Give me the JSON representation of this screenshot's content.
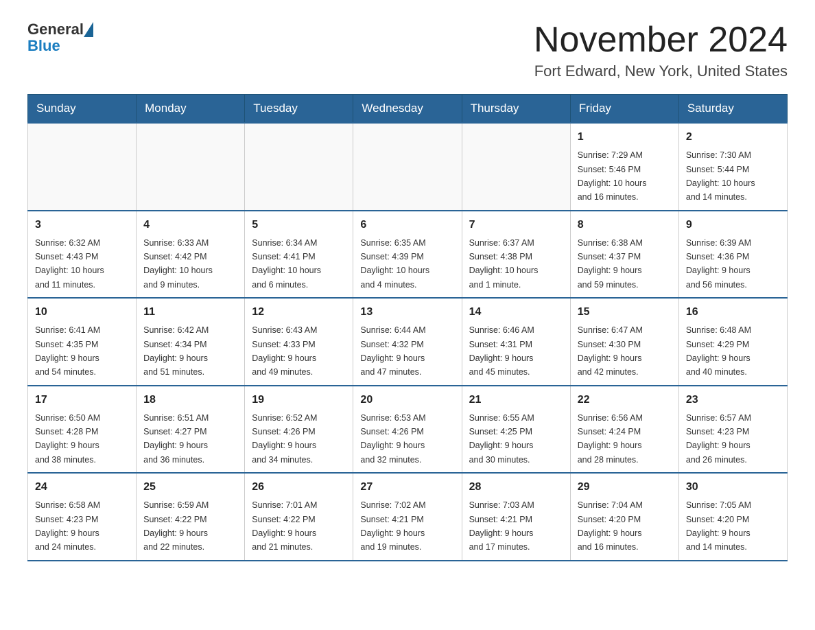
{
  "header": {
    "logo_general": "General",
    "logo_blue": "Blue",
    "month_title": "November 2024",
    "location": "Fort Edward, New York, United States"
  },
  "days_of_week": [
    "Sunday",
    "Monday",
    "Tuesday",
    "Wednesday",
    "Thursday",
    "Friday",
    "Saturday"
  ],
  "weeks": [
    [
      {
        "day": "",
        "info": ""
      },
      {
        "day": "",
        "info": ""
      },
      {
        "day": "",
        "info": ""
      },
      {
        "day": "",
        "info": ""
      },
      {
        "day": "",
        "info": ""
      },
      {
        "day": "1",
        "info": "Sunrise: 7:29 AM\nSunset: 5:46 PM\nDaylight: 10 hours\nand 16 minutes."
      },
      {
        "day": "2",
        "info": "Sunrise: 7:30 AM\nSunset: 5:44 PM\nDaylight: 10 hours\nand 14 minutes."
      }
    ],
    [
      {
        "day": "3",
        "info": "Sunrise: 6:32 AM\nSunset: 4:43 PM\nDaylight: 10 hours\nand 11 minutes."
      },
      {
        "day": "4",
        "info": "Sunrise: 6:33 AM\nSunset: 4:42 PM\nDaylight: 10 hours\nand 9 minutes."
      },
      {
        "day": "5",
        "info": "Sunrise: 6:34 AM\nSunset: 4:41 PM\nDaylight: 10 hours\nand 6 minutes."
      },
      {
        "day": "6",
        "info": "Sunrise: 6:35 AM\nSunset: 4:39 PM\nDaylight: 10 hours\nand 4 minutes."
      },
      {
        "day": "7",
        "info": "Sunrise: 6:37 AM\nSunset: 4:38 PM\nDaylight: 10 hours\nand 1 minute."
      },
      {
        "day": "8",
        "info": "Sunrise: 6:38 AM\nSunset: 4:37 PM\nDaylight: 9 hours\nand 59 minutes."
      },
      {
        "day": "9",
        "info": "Sunrise: 6:39 AM\nSunset: 4:36 PM\nDaylight: 9 hours\nand 56 minutes."
      }
    ],
    [
      {
        "day": "10",
        "info": "Sunrise: 6:41 AM\nSunset: 4:35 PM\nDaylight: 9 hours\nand 54 minutes."
      },
      {
        "day": "11",
        "info": "Sunrise: 6:42 AM\nSunset: 4:34 PM\nDaylight: 9 hours\nand 51 minutes."
      },
      {
        "day": "12",
        "info": "Sunrise: 6:43 AM\nSunset: 4:33 PM\nDaylight: 9 hours\nand 49 minutes."
      },
      {
        "day": "13",
        "info": "Sunrise: 6:44 AM\nSunset: 4:32 PM\nDaylight: 9 hours\nand 47 minutes."
      },
      {
        "day": "14",
        "info": "Sunrise: 6:46 AM\nSunset: 4:31 PM\nDaylight: 9 hours\nand 45 minutes."
      },
      {
        "day": "15",
        "info": "Sunrise: 6:47 AM\nSunset: 4:30 PM\nDaylight: 9 hours\nand 42 minutes."
      },
      {
        "day": "16",
        "info": "Sunrise: 6:48 AM\nSunset: 4:29 PM\nDaylight: 9 hours\nand 40 minutes."
      }
    ],
    [
      {
        "day": "17",
        "info": "Sunrise: 6:50 AM\nSunset: 4:28 PM\nDaylight: 9 hours\nand 38 minutes."
      },
      {
        "day": "18",
        "info": "Sunrise: 6:51 AM\nSunset: 4:27 PM\nDaylight: 9 hours\nand 36 minutes."
      },
      {
        "day": "19",
        "info": "Sunrise: 6:52 AM\nSunset: 4:26 PM\nDaylight: 9 hours\nand 34 minutes."
      },
      {
        "day": "20",
        "info": "Sunrise: 6:53 AM\nSunset: 4:26 PM\nDaylight: 9 hours\nand 32 minutes."
      },
      {
        "day": "21",
        "info": "Sunrise: 6:55 AM\nSunset: 4:25 PM\nDaylight: 9 hours\nand 30 minutes."
      },
      {
        "day": "22",
        "info": "Sunrise: 6:56 AM\nSunset: 4:24 PM\nDaylight: 9 hours\nand 28 minutes."
      },
      {
        "day": "23",
        "info": "Sunrise: 6:57 AM\nSunset: 4:23 PM\nDaylight: 9 hours\nand 26 minutes."
      }
    ],
    [
      {
        "day": "24",
        "info": "Sunrise: 6:58 AM\nSunset: 4:23 PM\nDaylight: 9 hours\nand 24 minutes."
      },
      {
        "day": "25",
        "info": "Sunrise: 6:59 AM\nSunset: 4:22 PM\nDaylight: 9 hours\nand 22 minutes."
      },
      {
        "day": "26",
        "info": "Sunrise: 7:01 AM\nSunset: 4:22 PM\nDaylight: 9 hours\nand 21 minutes."
      },
      {
        "day": "27",
        "info": "Sunrise: 7:02 AM\nSunset: 4:21 PM\nDaylight: 9 hours\nand 19 minutes."
      },
      {
        "day": "28",
        "info": "Sunrise: 7:03 AM\nSunset: 4:21 PM\nDaylight: 9 hours\nand 17 minutes."
      },
      {
        "day": "29",
        "info": "Sunrise: 7:04 AM\nSunset: 4:20 PM\nDaylight: 9 hours\nand 16 minutes."
      },
      {
        "day": "30",
        "info": "Sunrise: 7:05 AM\nSunset: 4:20 PM\nDaylight: 9 hours\nand 14 minutes."
      }
    ]
  ]
}
